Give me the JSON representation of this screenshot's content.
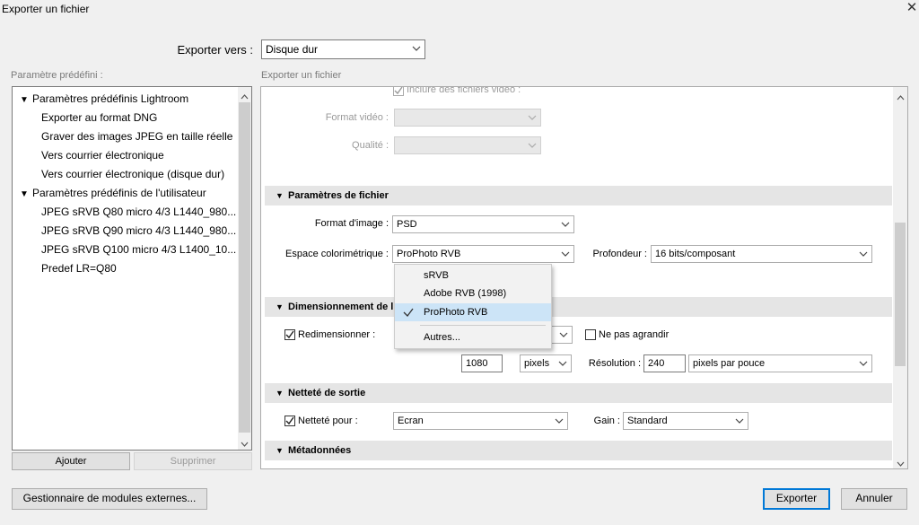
{
  "window": {
    "title": "Exporter un fichier",
    "close_glyph": "✕"
  },
  "export_to": {
    "label": "Exporter vers :",
    "value": "Disque dur"
  },
  "presets": {
    "caption": "Paramètre prédéfini :",
    "groups": [
      {
        "label": "Paramètres prédéfinis Lightroom",
        "items": [
          "Exporter au format DNG",
          "Graver des images JPEG en taille réelle",
          "Vers courrier électronique",
          "Vers courrier électronique (disque dur)"
        ]
      },
      {
        "label": "Paramètres prédéfinis de l'utilisateur",
        "items": [
          "JPEG sRVB Q80 micro 4/3 L1440_980...",
          "JPEG sRVB Q90 micro 4/3 L1440_980...",
          "JPEG sRVB Q100 micro 4/3 L1400_10...",
          "Predef LR=Q80"
        ]
      }
    ],
    "add_label": "Ajouter",
    "remove_label": "Supprimer"
  },
  "panel": {
    "caption": "Exporter un fichier",
    "video": {
      "include_label": "Inclure des fichiers vidéo :",
      "format_label": "Format vidéo :",
      "quality_label": "Qualité :"
    },
    "file_settings": {
      "header": "Paramètres de fichier",
      "format_label": "Format d'image :",
      "format_value": "PSD",
      "colorspace_label": "Espace colorimétrique :",
      "colorspace_value": "ProPhoto RVB",
      "depth_label": "Profondeur :",
      "depth_value": "16 bits/composant"
    },
    "colorspace_menu": {
      "options": [
        "sRVB",
        "Adobe RVB (1998)",
        "ProPhoto RVB",
        "Autres..."
      ],
      "selected": "ProPhoto RVB"
    },
    "sizing": {
      "header": "Dimensionnement de l",
      "resize_label": "Redimensionner :",
      "resize_checked": true,
      "no_enlarge_label": "Ne pas agrandir",
      "no_enlarge_checked": false,
      "size_value": "1080",
      "unit_value": "pixels",
      "resolution_label": "Résolution :",
      "resolution_value": "240",
      "res_unit_value": "pixels par pouce"
    },
    "sharpening": {
      "header": "Netteté de sortie",
      "sharpen_label": "Netteté pour :",
      "sharpen_checked": true,
      "sharpen_value": "Ecran",
      "amount_label": "Gain :",
      "amount_value": "Standard"
    },
    "metadata": {
      "header": "Métadonnées"
    }
  },
  "footer": {
    "plugin_manager_label": "Gestionnaire de modules externes...",
    "export_label": "Exporter",
    "cancel_label": "Annuler"
  },
  "colors": {
    "accent": "#0078d7",
    "menu_selection": "#cce4f7",
    "section_bg": "#e5e5e5"
  }
}
